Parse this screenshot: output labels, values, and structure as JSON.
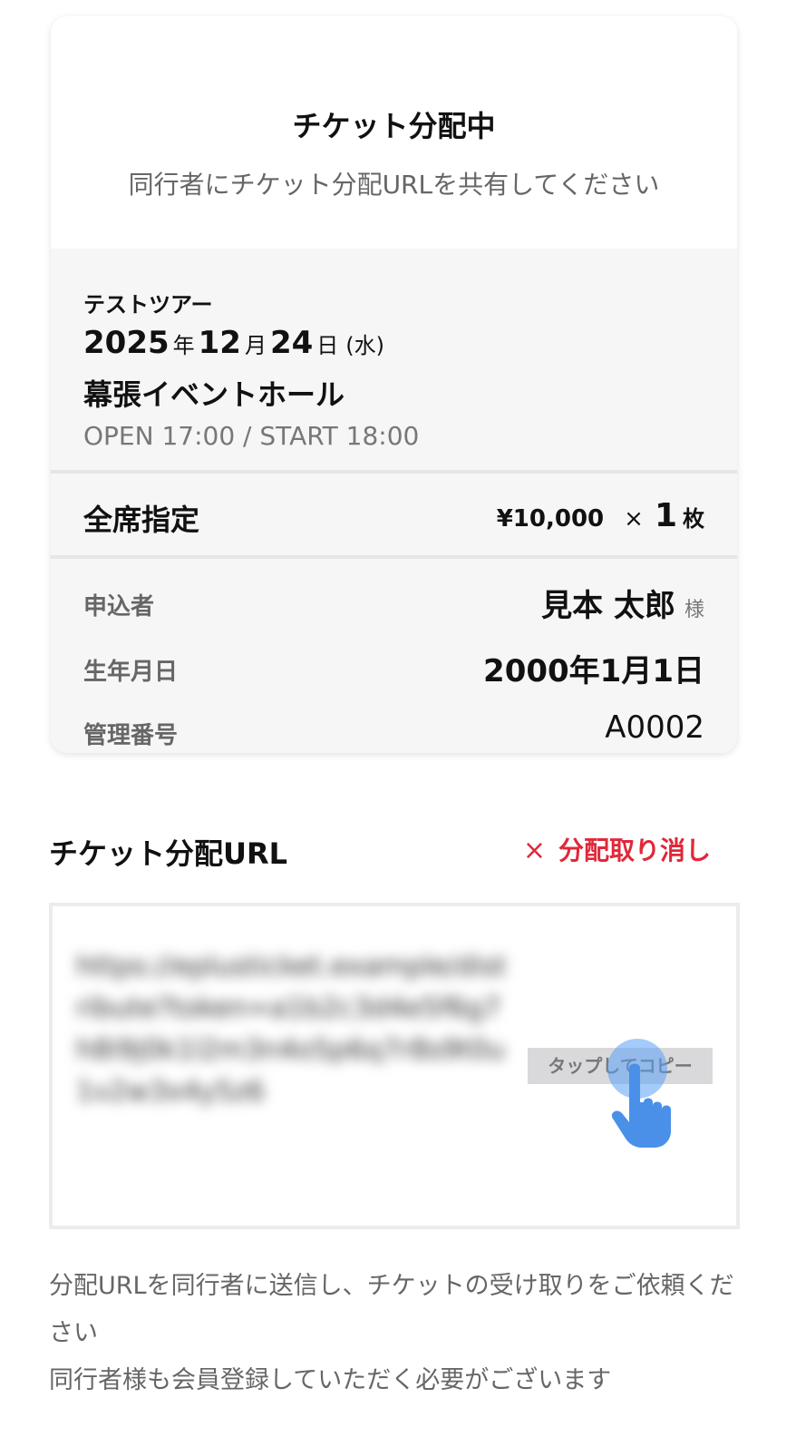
{
  "header": {
    "title": "チケット分配中",
    "subtitle": "同行者にチケット分配URLを共有してください"
  },
  "event": {
    "tour_name": "テストツアー",
    "date": {
      "year": "2025",
      "year_unit": "年",
      "month": "12",
      "month_unit": "月",
      "day": "24",
      "day_unit": "日",
      "weekday": "(水)"
    },
    "venue": "幕張イベントホール",
    "times": "OPEN 17:00 / START 18:00"
  },
  "seat": {
    "name": "全席指定",
    "price": "¥10,000",
    "times_sign": "×",
    "quantity": "1",
    "unit": "枚"
  },
  "applicant": {
    "name_label": "申込者",
    "name": "見本 太郎",
    "honorific": "様",
    "birthdate_label": "生年月日",
    "birthdate": "2000年1月1日",
    "management_label": "管理番号",
    "management_number": "A0002"
  },
  "distribution": {
    "title": "チケット分配URL",
    "cancel_icon": "×",
    "cancel_label": "分配取り消し",
    "url_blurred": "https://eplusticket.example/distribute?token=a1b2c3d4e5f6g7h8i9j0k1l2m3n4o5p6q7r8s9t0u1v2w3x4y5z6",
    "copy_label": "タップしてコピー",
    "tap_icon": "hand-pointer-icon",
    "accent_color": "#e0283a",
    "tap_color": "#4a90e8"
  },
  "notes": {
    "line1": "分配URLを同行者に送信し、チケットの受け取りをご依頼ください",
    "line2": "同行者様も会員登録していただく必要がございます"
  }
}
